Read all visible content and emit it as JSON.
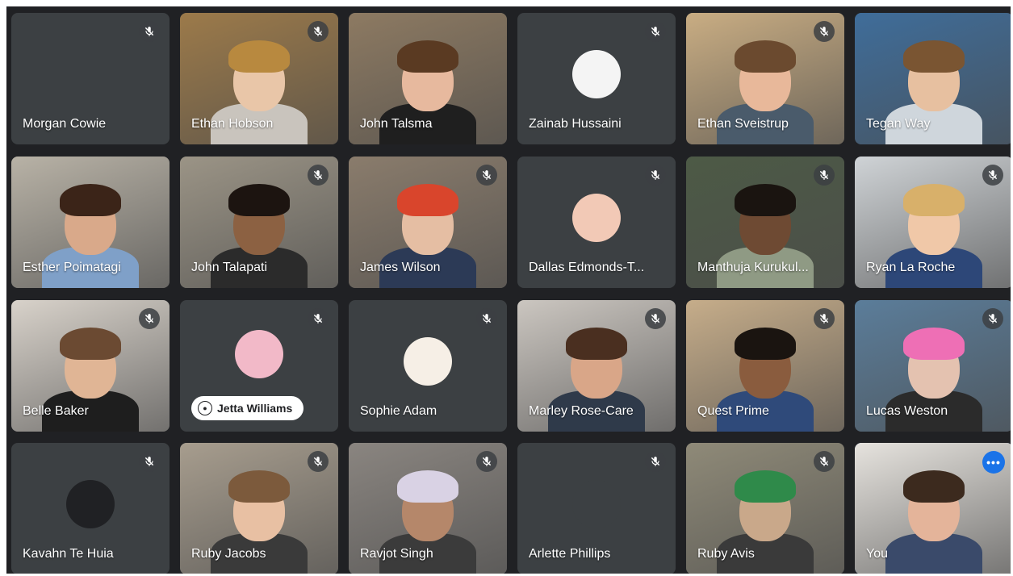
{
  "participants": [
    {
      "name": "Morgan Cowie",
      "muted": true,
      "type": "blank"
    },
    {
      "name": "Ethan Hobson",
      "muted": true,
      "type": "video",
      "bg": "#9c7a4a",
      "skin": "#e9c6a8",
      "hair": "#b8893f",
      "shirt": "#c9c4bd"
    },
    {
      "name": "John Talsma",
      "muted": false,
      "type": "video",
      "bg": "#8d7a62",
      "skin": "#e7b99e",
      "hair": "#5a3a22",
      "shirt": "#1f1f1f"
    },
    {
      "name": "Zainab Hussaini",
      "muted": true,
      "type": "avatar",
      "avatar_bg": "#f4f4f4"
    },
    {
      "name": "Ethan Sveistrup",
      "muted": true,
      "type": "video",
      "bg": "#c9ad83",
      "skin": "#e8b89a",
      "hair": "#6b4a2f",
      "shirt": "#4a5b6b"
    },
    {
      "name": "Tegan Way",
      "muted": false,
      "type": "video",
      "bg": "#3f6d9a",
      "skin": "#e7c0a0",
      "hair": "#7a5532",
      "shirt": "#cfd6dc"
    },
    {
      "name": "Esther Poimatagi",
      "muted": false,
      "type": "video",
      "bg": "#b8b2a6",
      "skin": "#d9a98a",
      "hair": "#3b2418",
      "shirt": "#7fa0c8"
    },
    {
      "name": "John Talapati",
      "muted": true,
      "type": "video",
      "bg": "#9b9486",
      "skin": "#8c6142",
      "hair": "#1c1410",
      "shirt": "#2b2b2b"
    },
    {
      "name": "James Wilson",
      "muted": true,
      "type": "video",
      "bg": "#8a7c6c",
      "skin": "#e5bea3",
      "hair": "#d9452c",
      "shirt": "#2c3a56"
    },
    {
      "name": "Dallas Edmonds-T...",
      "muted": true,
      "type": "avatar",
      "avatar_bg": "#f2c9b6"
    },
    {
      "name": "Manthuja Kurukul...",
      "muted": true,
      "type": "video",
      "bg": "#4d5a46",
      "skin": "#6e4a33",
      "hair": "#1a1410",
      "shirt": "#8f9a84"
    },
    {
      "name": "Ryan La Roche",
      "muted": true,
      "type": "video",
      "bg": "#cfd3d6",
      "skin": "#f0c8a8",
      "hair": "#d8b06a",
      "shirt": "#2d4778"
    },
    {
      "name": "Belle Baker",
      "muted": true,
      "type": "video",
      "bg": "#d8d2ca",
      "skin": "#e0b595",
      "hair": "#6b4a32",
      "shirt": "#1e1e1e"
    },
    {
      "name": "Jetta Williams",
      "muted": true,
      "type": "avatar-pill",
      "avatar_bg": "#f2b9c8"
    },
    {
      "name": "Sophie Adam",
      "muted": true,
      "type": "avatar",
      "avatar_bg": "#f6efe6"
    },
    {
      "name": "Marley Rose-Care",
      "muted": true,
      "type": "video",
      "bg": "#cbc6c0",
      "skin": "#d9a688",
      "hair": "#4a2f20",
      "shirt": "#2f3a4a"
    },
    {
      "name": "Quest Prime",
      "muted": true,
      "type": "video",
      "bg": "#c6ad8a",
      "skin": "#8a5c3e",
      "hair": "#1a1410",
      "shirt": "#2f4a7a"
    },
    {
      "name": "Lucas Weston",
      "muted": true,
      "type": "video",
      "bg": "#5b7d9a",
      "skin": "#e4c2b0",
      "hair": "#ee6fb5",
      "shirt": "#2b2b2b"
    },
    {
      "name": "Kavahn Te Huia",
      "muted": true,
      "type": "avatar",
      "avatar_bg": "#202124"
    },
    {
      "name": "Ruby Jacobs",
      "muted": true,
      "type": "video",
      "bg": "#a79d8e",
      "skin": "#e8c0a3",
      "hair": "#7c5a3c",
      "shirt": "#3a3a3a"
    },
    {
      "name": "Ravjot Singh",
      "muted": true,
      "type": "video",
      "bg": "#8a8580",
      "skin": "#b5876a",
      "hair": "#d9d2e4",
      "shirt": "#3b3b3b"
    },
    {
      "name": "Arlette Phillips",
      "muted": true,
      "type": "avatar",
      "avatar_bg": "#3c4043"
    },
    {
      "name": "Ruby Avis",
      "muted": true,
      "type": "video",
      "bg": "#8f8a78",
      "skin": "#c9a88a",
      "hair": "#2f8a4a",
      "shirt": "#3a3a3a"
    },
    {
      "name": "You",
      "muted": false,
      "type": "video-self",
      "bg": "#e6e3de",
      "skin": "#e4b49a",
      "hair": "#3c2a1e",
      "shirt": "#3a4a6a"
    }
  ],
  "self_more_label": "•••"
}
